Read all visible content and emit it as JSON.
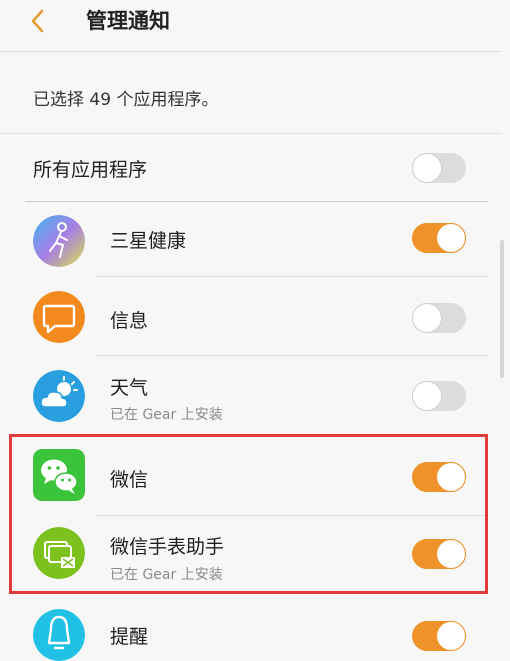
{
  "header": {
    "title": "管理通知"
  },
  "summary": "已选择 49 个应用程序。",
  "all_apps": {
    "label": "所有应用程序",
    "enabled": false
  },
  "apps": [
    {
      "name": "三星健康",
      "subtitle": "",
      "enabled": true,
      "icon": "samsung-health-icon"
    },
    {
      "name": "信息",
      "subtitle": "",
      "enabled": false,
      "icon": "messages-icon"
    },
    {
      "name": "天气",
      "subtitle": "已在 Gear 上安装",
      "enabled": false,
      "icon": "weather-icon"
    },
    {
      "name": "微信",
      "subtitle": "",
      "enabled": true,
      "icon": "wechat-icon"
    },
    {
      "name": "微信手表助手",
      "subtitle": "已在 Gear 上安装",
      "enabled": true,
      "icon": "wechat-watch-assistant-icon"
    },
    {
      "name": "提醒",
      "subtitle": "",
      "enabled": true,
      "icon": "reminder-icon"
    }
  ],
  "colors": {
    "accent": "#f0922a",
    "highlight": "#e03a3a",
    "toggle_off": "#dcdcdc"
  }
}
